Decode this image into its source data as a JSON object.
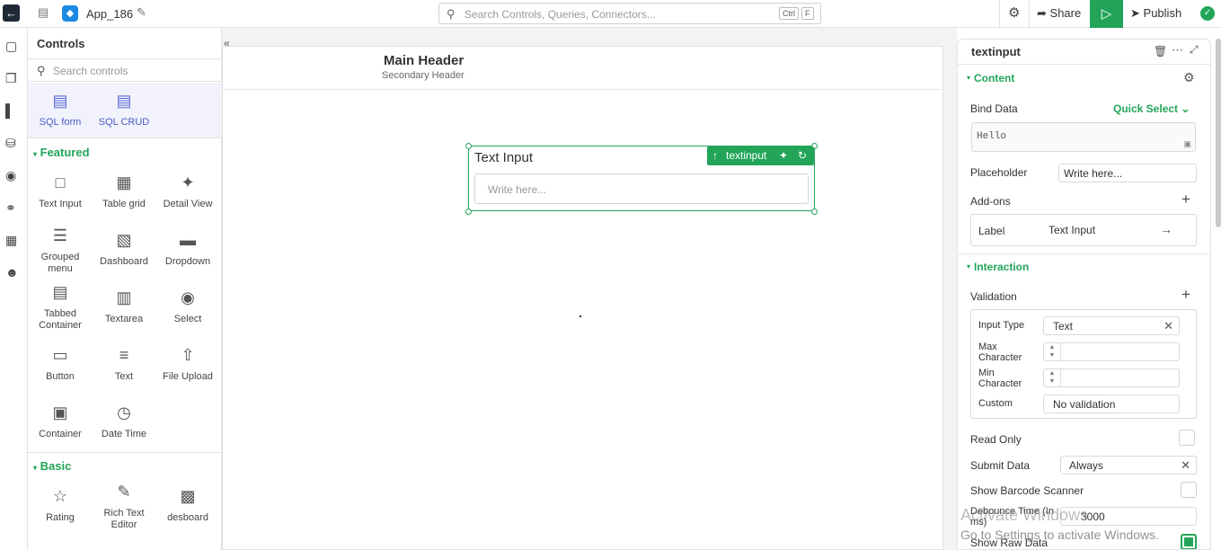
{
  "topbar": {
    "app_name": "App_186",
    "search_placeholder": "Search Controls, Queries, Connectors...",
    "kbd_ctrl": "Ctrl",
    "kbd_f": "F",
    "share_label": "Share",
    "publish_label": "Publish"
  },
  "controls_panel": {
    "title": "Controls",
    "search_placeholder": "Search controls",
    "sql_items": [
      {
        "label": "SQL form",
        "icon": "sql-form-icon"
      },
      {
        "label": "SQL CRUD",
        "icon": "sql-crud-icon"
      }
    ],
    "featured_title": "Featured",
    "featured_items": [
      {
        "label": "Text Input",
        "icon": "text-input-icon"
      },
      {
        "label": "Table grid",
        "icon": "table-grid-icon"
      },
      {
        "label": "Detail View",
        "icon": "magic-wand-icon"
      },
      {
        "label": "Grouped menu",
        "icon": "grouped-menu-icon"
      },
      {
        "label": "Dashboard",
        "icon": "dashboard-icon"
      },
      {
        "label": "Dropdown",
        "icon": "dropdown-icon"
      },
      {
        "label": "Tabbed Container",
        "icon": "tabbed-container-icon"
      },
      {
        "label": "Textarea",
        "icon": "textarea-icon"
      },
      {
        "label": "Select",
        "icon": "select-icon"
      },
      {
        "label": "Button",
        "icon": "button-icon"
      },
      {
        "label": "Text",
        "icon": "text-icon"
      },
      {
        "label": "File Upload",
        "icon": "file-upload-icon"
      },
      {
        "label": "Container",
        "icon": "container-icon"
      },
      {
        "label": "Date Time",
        "icon": "date-time-icon"
      }
    ],
    "basic_title": "Basic",
    "basic_items": [
      {
        "label": "Rating",
        "icon": "star-icon"
      },
      {
        "label": "Rich Text Editor",
        "icon": "rich-text-icon"
      },
      {
        "label": "desboard",
        "icon": "desboard-icon"
      }
    ]
  },
  "canvas": {
    "main_header": "Main Header",
    "secondary_header": "Secondary Header",
    "control_title": "Text Input",
    "control_placeholder": "Write here...",
    "control_tag": "textinput"
  },
  "properties": {
    "title": "textinput",
    "content_section": "Content",
    "bind_data_label": "Bind Data",
    "quick_select_label": "Quick Select",
    "bind_data_value": "Hello",
    "placeholder_label": "Placeholder",
    "placeholder_value": "Write here...",
    "addons_label": "Add-ons",
    "addon_key": "Label",
    "addon_value": "Text Input",
    "interaction_section": "Interaction",
    "validation_label": "Validation",
    "input_type_label": "Input Type",
    "input_type_value": "Text",
    "max_char_label": "Max Character",
    "min_char_label": "Min Character",
    "custom_label": "Custom",
    "custom_value": "No validation",
    "read_only_label": "Read Only",
    "submit_data_label": "Submit Data",
    "submit_data_value": "Always",
    "barcode_label": "Show Barcode Scanner",
    "debounce_label": "Debounce Time (In ms)",
    "debounce_value": "3000",
    "raw_data_label": "Show Raw Data"
  },
  "watermark": {
    "line1": "Activate Windows",
    "line2": "Go to Settings to activate Windows."
  },
  "colors": {
    "accent": "#22a559",
    "topbar_back": "#1f2937"
  }
}
